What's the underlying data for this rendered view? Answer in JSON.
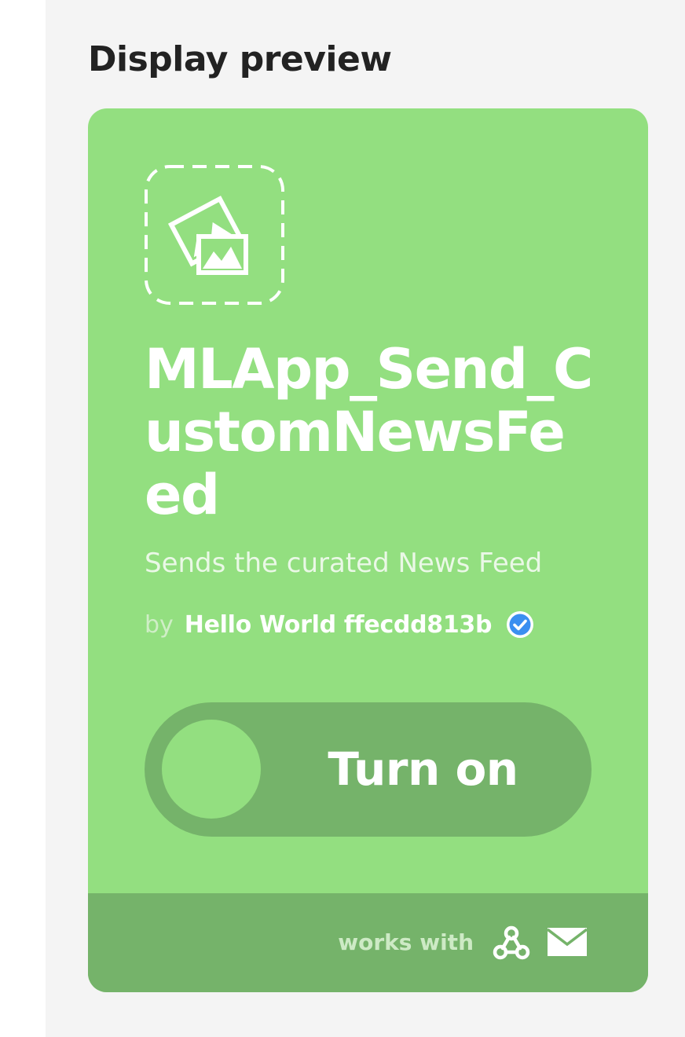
{
  "section": {
    "title": "Display preview"
  },
  "card": {
    "image_icon": "photos-placeholder-icon",
    "title": "MLApp_Send_CustomNewsFeed",
    "description": "Sends the curated News Feed",
    "by_label": "by",
    "author": "Hello World ffecdd813b",
    "verified_icon": "verified-check-icon",
    "toggle": {
      "label": "Turn on",
      "state": "off"
    },
    "footer": {
      "works_with_label": "works with",
      "services": [
        "webhooks-icon",
        "email-icon"
      ]
    },
    "colors": {
      "card_background": "#93df80",
      "toggle_background": "#75b36a",
      "footer_background": "#75b36a",
      "verified_badge": "#3b8ff0"
    }
  }
}
